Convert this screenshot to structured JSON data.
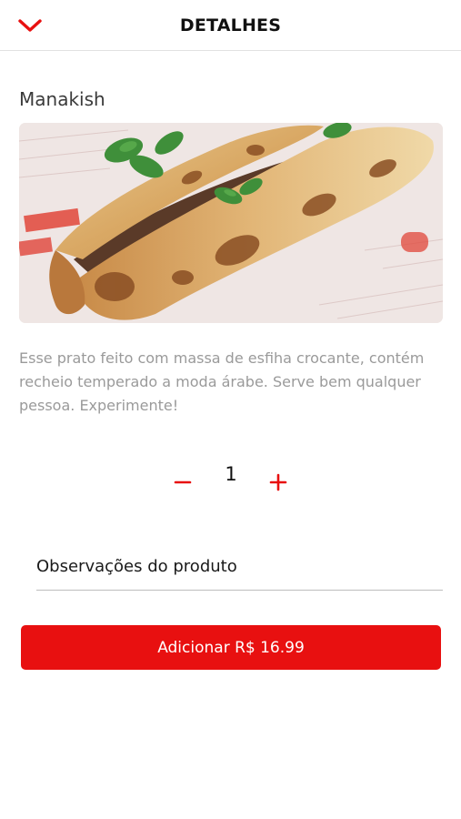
{
  "header": {
    "title": "DETALHES",
    "back_icon": "chevron-down-icon",
    "accent_color": "#e81010"
  },
  "product": {
    "name": "Manakish",
    "image_icon": "food-photo",
    "description": "Esse prato feito com massa de esfiha crocante, contém recheio temperado a moda árabe. Serve bem qualquer pessoa. Experimente!"
  },
  "quantity": {
    "value": "1",
    "minus_icon": "minus-icon",
    "plus_icon": "plus-icon"
  },
  "notes": {
    "placeholder": "Observações do produto",
    "value": ""
  },
  "add_button": {
    "label": "Adicionar R$ 16.99",
    "color": "#e81010"
  }
}
